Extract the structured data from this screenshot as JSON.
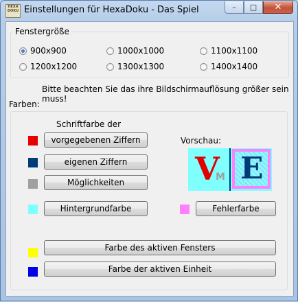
{
  "window": {
    "icon_text": "HEXA DOKU",
    "title": "Einstellungen für HexaDoku - Das Spiel",
    "minimize_glyph": "–",
    "maximize_glyph": "□",
    "close_glyph": "✕"
  },
  "window_size_group": {
    "legend": "Fenstergröße",
    "selected": "900x900",
    "options": [
      "900x900",
      "1000x1000",
      "1100x1100",
      "1200x1200",
      "1300x1300",
      "1400x1400"
    ]
  },
  "resolution_note": "Bitte beachten Sie das ihre Bildschirmauflösung größer sein muss!",
  "colors_group": {
    "legend": "Farben:",
    "font_color_heading": "Schriftfarbe der",
    "preview_label": "Vorschau:",
    "buttons": {
      "given_digits": "vorgegebenen Ziffern",
      "own_digits": "eigenen Ziffern",
      "possibilities": "Möglichkeiten",
      "background": "Hintergrundfarbe",
      "error": "Fehlerfarbe",
      "active_window": "Farbe des aktiven Fensters",
      "active_unit": "Farbe der aktiven Einheit"
    },
    "swatch_colors": {
      "given_digits": "#e80000",
      "own_digits": "#003a78",
      "possibilities": "#a0a0a0",
      "background": "#80ffff",
      "error": "#ff80ff",
      "active_window": "#ffff00",
      "active_unit": "#0000e8"
    },
    "preview": {
      "given_char": "V",
      "possibility_char": "M",
      "own_char": "E"
    }
  }
}
